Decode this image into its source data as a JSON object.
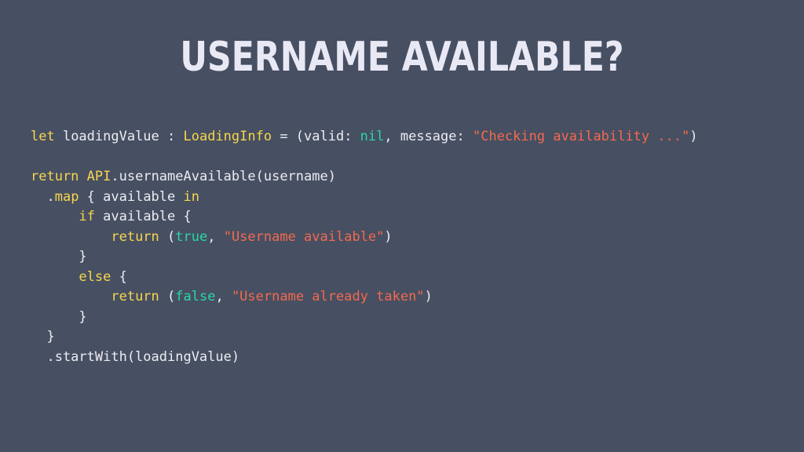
{
  "slide": {
    "title": "USERNAME AVAILABLE?"
  },
  "code": {
    "lines": [
      [
        {
          "t": "let",
          "k": "kw"
        },
        {
          "t": " loadingValue : ",
          "k": "plain"
        },
        {
          "t": "LoadingInfo",
          "k": "kw"
        },
        {
          "t": " = (valid: ",
          "k": "plain"
        },
        {
          "t": "nil",
          "k": "lit"
        },
        {
          "t": ", message: ",
          "k": "plain"
        },
        {
          "t": "\"Checking availability ...\"",
          "k": "str"
        },
        {
          "t": ")",
          "k": "plain"
        }
      ],
      [],
      [
        {
          "t": "return",
          "k": "kw"
        },
        {
          "t": " ",
          "k": "plain"
        },
        {
          "t": "API",
          "k": "kw"
        },
        {
          "t": ".usernameAvailable(username)",
          "k": "plain"
        }
      ],
      [
        {
          "t": "  .",
          "k": "plain"
        },
        {
          "t": "map",
          "k": "kw"
        },
        {
          "t": " { available ",
          "k": "plain"
        },
        {
          "t": "in",
          "k": "kw"
        }
      ],
      [
        {
          "t": "      ",
          "k": "plain"
        },
        {
          "t": "if",
          "k": "kw"
        },
        {
          "t": " available {",
          "k": "plain"
        }
      ],
      [
        {
          "t": "          ",
          "k": "plain"
        },
        {
          "t": "return",
          "k": "kw"
        },
        {
          "t": " (",
          "k": "plain"
        },
        {
          "t": "true",
          "k": "lit"
        },
        {
          "t": ", ",
          "k": "plain"
        },
        {
          "t": "\"Username available\"",
          "k": "str"
        },
        {
          "t": ")",
          "k": "plain"
        }
      ],
      [
        {
          "t": "      }",
          "k": "plain"
        }
      ],
      [
        {
          "t": "      ",
          "k": "plain"
        },
        {
          "t": "else",
          "k": "kw"
        },
        {
          "t": " {",
          "k": "plain"
        }
      ],
      [
        {
          "t": "          ",
          "k": "plain"
        },
        {
          "t": "return",
          "k": "kw"
        },
        {
          "t": " (",
          "k": "plain"
        },
        {
          "t": "false",
          "k": "lit"
        },
        {
          "t": ", ",
          "k": "plain"
        },
        {
          "t": "\"Username already taken\"",
          "k": "str"
        },
        {
          "t": ")",
          "k": "plain"
        }
      ],
      [
        {
          "t": "      }",
          "k": "plain"
        }
      ],
      [
        {
          "t": "  }",
          "k": "plain"
        }
      ],
      [
        {
          "t": "  .startWith(loadingValue)",
          "k": "plain"
        }
      ]
    ]
  },
  "colors": {
    "background": "#474f62",
    "title": "#e9e9f5",
    "keyword": "#f7d64d",
    "literal": "#29d8a5",
    "string": "#f26a4f",
    "plain": "#ecedf2"
  }
}
